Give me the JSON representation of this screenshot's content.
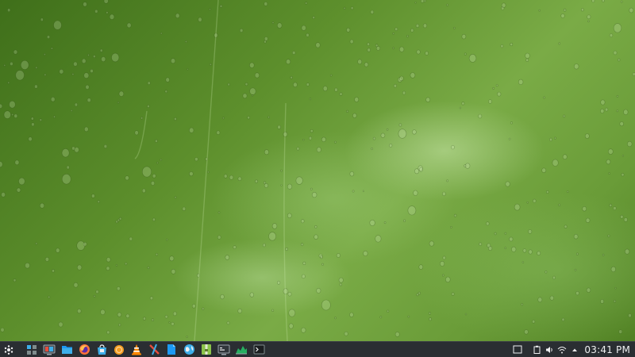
{
  "desktop": {
    "wallpaper": "green-raindrops-wallpaper",
    "colors": {
      "wallpaper_dark": "#3f6f1a",
      "wallpaper_light": "#9cc76a",
      "panel_bg": "#2a2e32",
      "panel_text": "#eff0f1"
    }
  },
  "taskbar": {
    "launcher_icon": "application-launcher-icon",
    "tasks": [
      {
        "icon": "pager-icon"
      },
      {
        "icon": "system-settings-icon"
      },
      {
        "icon": "file-manager-icon"
      },
      {
        "icon": "firefox-icon"
      },
      {
        "icon": "discover-store-icon"
      },
      {
        "icon": "orange-app-icon"
      },
      {
        "icon": "vlc-icon"
      },
      {
        "icon": "krita-icon"
      },
      {
        "icon": "document-icon"
      },
      {
        "icon": "globe-icon"
      },
      {
        "icon": "archive-icon"
      },
      {
        "icon": "system-monitor-icon"
      },
      {
        "icon": "graph-app-icon"
      },
      {
        "icon": "terminal-icon"
      }
    ],
    "tray": {
      "icons": [
        "show-desktop-icon",
        "clipboard-icon",
        "volume-icon",
        "network-icon",
        "expand-tray-arrow-icon"
      ],
      "clock": "03:41 PM"
    }
  }
}
